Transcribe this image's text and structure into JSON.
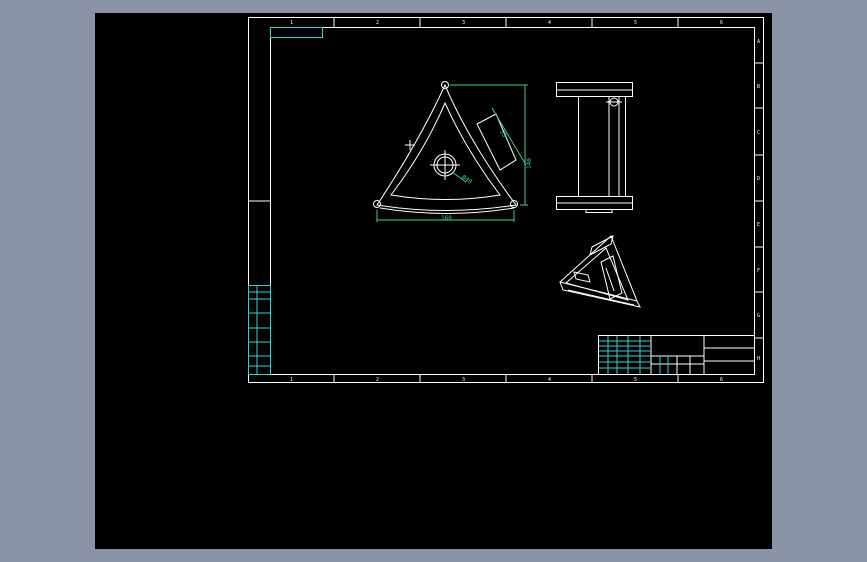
{
  "viewer": {
    "background_color": "#8a93a6",
    "canvas_color": "#000000",
    "line_color": "#ffffff",
    "dimension_color": "#3fd08a",
    "table_color": "#2fd3d3"
  },
  "sheet": {
    "zone_numbers_top": [
      "1",
      "2",
      "3",
      "4",
      "5",
      "6"
    ],
    "zone_numbers_bottom": [
      "1",
      "2",
      "3",
      "4",
      "5",
      "6"
    ],
    "zone_letters_right": [
      "A",
      "B",
      "C",
      "D",
      "E",
      "F",
      "G",
      "H"
    ]
  },
  "dimensions": {
    "bottom_width": "160",
    "right_height": "140",
    "slot_length": "55",
    "hole_diameter": "Ø40"
  }
}
